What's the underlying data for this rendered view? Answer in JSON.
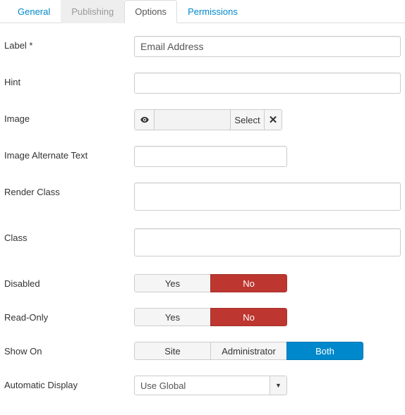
{
  "tabs": {
    "general": "General",
    "publishing": "Publishing",
    "options": "Options",
    "permissions": "Permissions"
  },
  "labels": {
    "label": "Label *",
    "hint": "Hint",
    "image": "Image",
    "image_alt": "Image Alternate Text",
    "render_class": "Render Class",
    "class": "Class",
    "disabled": "Disabled",
    "readonly": "Read-Only",
    "show_on": "Show On",
    "auto_display": "Automatic Display"
  },
  "values": {
    "label": "Email Address",
    "hint": "",
    "image_alt": "",
    "render_class": "",
    "class": "",
    "auto_display": "Use Global"
  },
  "image_picker": {
    "select": "Select"
  },
  "toggles": {
    "yes": "Yes",
    "no": "No"
  },
  "show_on": {
    "site": "Site",
    "admin": "Administrator",
    "both": "Both"
  }
}
